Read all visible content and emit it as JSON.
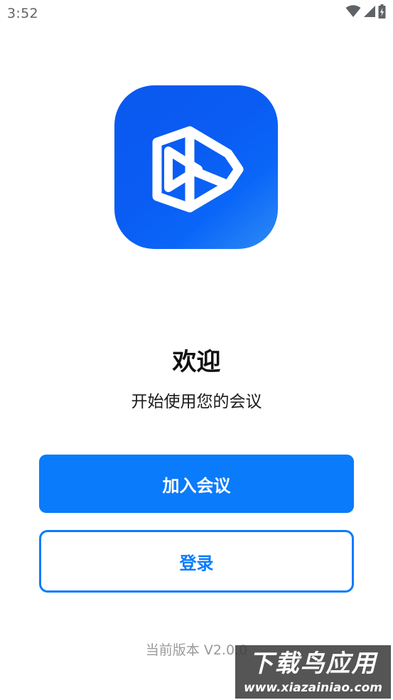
{
  "status_bar": {
    "time": "3:52",
    "icons": [
      "wifi-icon",
      "cellular-signal-icon",
      "battery-charging-icon"
    ]
  },
  "logo": {
    "icon": "play-logo-icon",
    "gradient_start": "#0a59f0",
    "gradient_end": "#2f8bf4"
  },
  "welcome": {
    "title": "欢迎",
    "subtitle": "开始使用您的会议"
  },
  "actions": {
    "join_label": "加入会议",
    "login_label": "登录"
  },
  "footer": {
    "version": "当前版本 V2.0.0"
  },
  "watermark": {
    "title": "下载鸟应用",
    "url": "www.xiazainiao.com"
  },
  "colors": {
    "accent": "#0a7bfb",
    "text_primary": "#111111",
    "text_muted": "#9a9a9a"
  }
}
